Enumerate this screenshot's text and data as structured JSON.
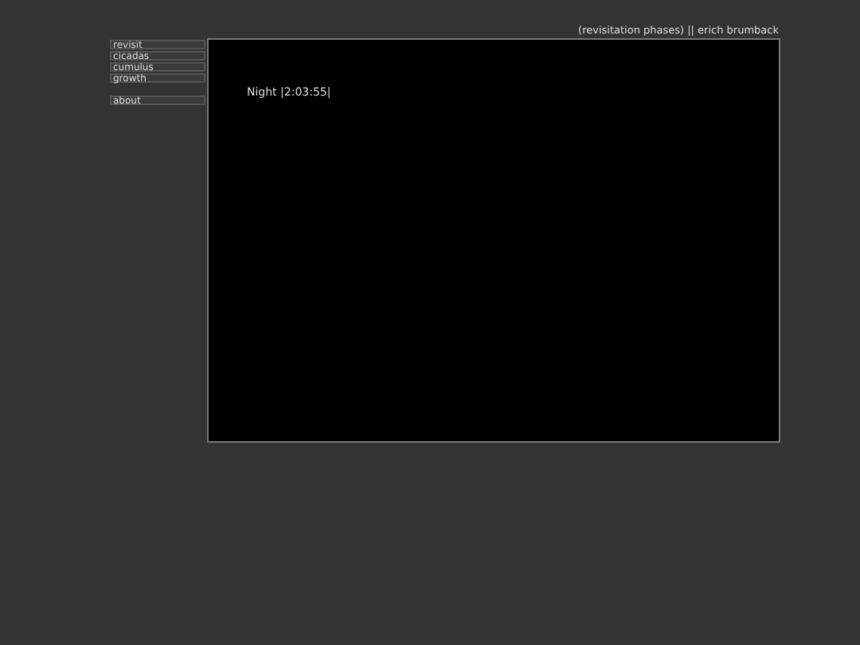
{
  "header": {
    "title": "(revisitation phases) || erich brumback"
  },
  "nav": {
    "groups": [
      [
        {
          "label": "revisit"
        },
        {
          "label": "cicadas"
        },
        {
          "label": "cumulus"
        },
        {
          "label": "growth"
        }
      ],
      [
        {
          "label": "about"
        }
      ]
    ]
  },
  "stage": {
    "status": "Night |2:03:55|"
  }
}
